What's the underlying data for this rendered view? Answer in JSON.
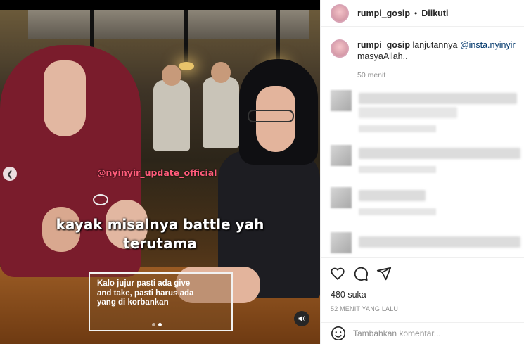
{
  "header": {
    "username": "rumpi_gosip",
    "separator": "•",
    "follow_label": "Diikuti"
  },
  "video": {
    "watermark": "@nyinyir_update_official",
    "caption_line1": "kayak misalnya battle yah",
    "caption_line2": "terutama",
    "subtitle_box": "Kalo jujur pasti ada give\nand take, pasti harus ada\nyang di korbankan",
    "slide_total": 2,
    "slide_active": 2,
    "nav_prev_icon": "chevron-left-icon",
    "audio_icon": "speaker-icon"
  },
  "caption": {
    "username": "rumpi_gosip",
    "text_before": "lanjutannya",
    "mention": "@insta.nyinyir",
    "text_after": "masyaAllah..",
    "time": "50 menit"
  },
  "actions": {
    "like_icon": "heart-icon",
    "comment_icon": "comment-icon",
    "share_icon": "share-icon"
  },
  "stats": {
    "likes": "480 suka",
    "posted": "52 MENIT YANG LALU"
  },
  "comment_box": {
    "emoji_icon": "emoji-icon",
    "placeholder": "Tambahkan komentar..."
  },
  "colors": {
    "mention": "#00376b",
    "muted": "#8e8e8e",
    "watermark": "#ff5c7a"
  }
}
